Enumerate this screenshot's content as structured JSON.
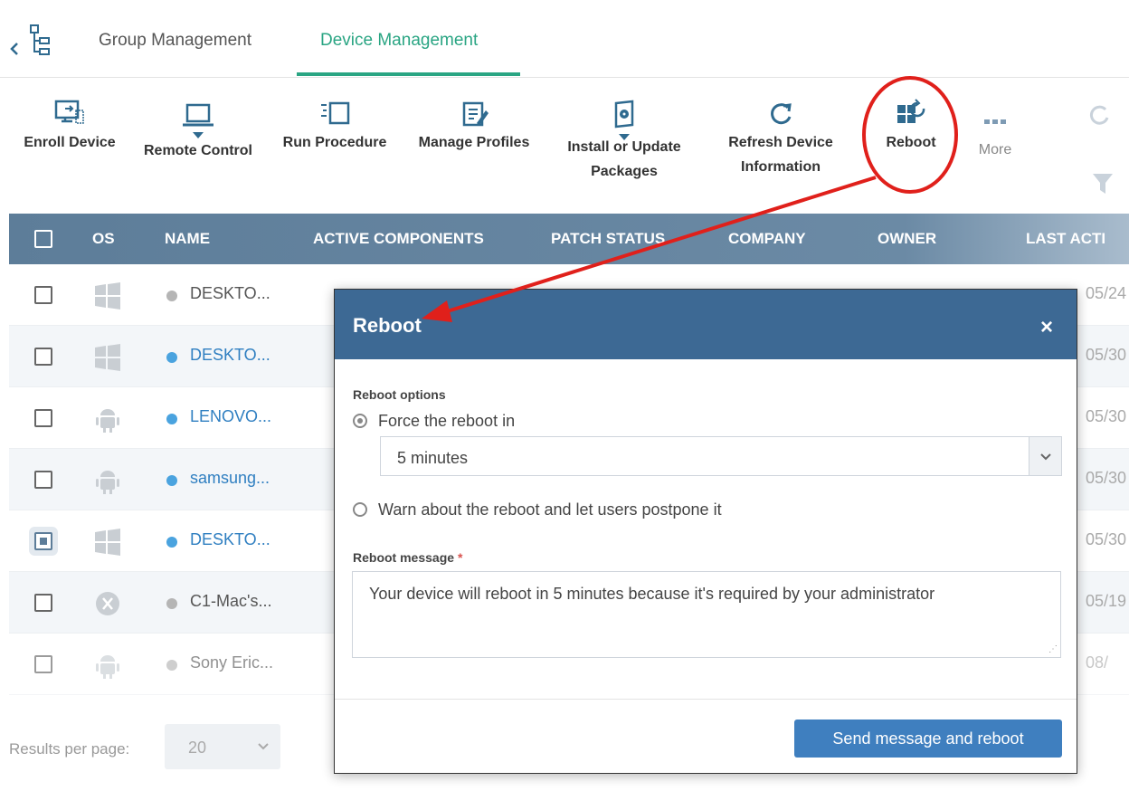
{
  "tabs": {
    "group_label": "Group Management",
    "device_label": "Device Management"
  },
  "toolbar": {
    "enroll_label": "Enroll Device",
    "remote_label": "Remote Control",
    "run_label": "Run Procedure",
    "manage_label": "Manage Profiles",
    "install_label_1": "Install or Update",
    "install_label_2": "Packages",
    "refresh_label_1": "Refresh Device",
    "refresh_label_2": "Information",
    "reboot_label": "Reboot",
    "more_label": "More"
  },
  "table": {
    "headers": {
      "os": "OS",
      "name": "NAME",
      "components": "ACTIVE COMPONENTS",
      "patch": "PATCH STATUS",
      "company": "COMPANY",
      "owner": "OWNER",
      "last": "LAST ACTI"
    },
    "rows": [
      {
        "name": "DESKTO...",
        "date": "05/24"
      },
      {
        "name": "DESKTO...",
        "date": "05/30"
      },
      {
        "name": "LENOVO...",
        "date": "05/30"
      },
      {
        "name": "samsung...",
        "date": "05/30"
      },
      {
        "name": "DESKTO...",
        "date": "05/30"
      },
      {
        "name": "C1-Mac's...",
        "date": "05/19"
      },
      {
        "name": "Sony Eric...",
        "date": "08/"
      }
    ]
  },
  "pagination": {
    "label": "Results per page:",
    "value": "20"
  },
  "modal": {
    "title": "Reboot",
    "close": "×",
    "options_label": "Reboot options",
    "force_label": "Force the reboot in",
    "select_value": "5 minutes",
    "warn_label": "Warn about the reboot and let users postpone it",
    "message_label": "Reboot message",
    "required_mark": "*",
    "message_text": "Your device will reboot in 5 minutes because it's required by your administrator",
    "send_button": "Send message and reboot"
  },
  "colors": {
    "accent_green": "#2aa583",
    "header_blue": "#3d6994",
    "button_blue": "#3f7fbf",
    "annotation_red": "#e0201b"
  }
}
